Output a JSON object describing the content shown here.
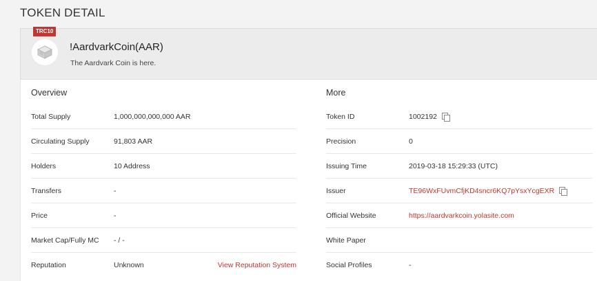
{
  "page": {
    "title": "TOKEN DETAIL"
  },
  "token": {
    "badge": "TRC10",
    "name": "!AardvarkCoin(AAR)",
    "description": "The Aardvark Coin is here."
  },
  "overview": {
    "title": "Overview",
    "rows": [
      {
        "label": "Total Supply",
        "value": "1,000,000,000,000 AAR"
      },
      {
        "label": "Circulating Supply",
        "value": "91,803 AAR"
      },
      {
        "label": "Holders",
        "value": "10 Address"
      },
      {
        "label": "Transfers",
        "value": "-"
      },
      {
        "label": "Price",
        "value": "-"
      },
      {
        "label": "Market Cap/Fully MC",
        "value": "- / -"
      },
      {
        "label": "Reputation",
        "value": "Unknown",
        "link": "View Reputation System"
      }
    ]
  },
  "more": {
    "title": "More",
    "rows": [
      {
        "label": "Token ID",
        "value": "1002192"
      },
      {
        "label": "Precision",
        "value": "0"
      },
      {
        "label": "Issuing Time",
        "value": "2019-03-18 15:29:33 (UTC)"
      },
      {
        "label": "Issuer",
        "value": "TE96WxFUvmCfjKD4sncr6KQ7pYsxYcgEXR"
      },
      {
        "label": "Official Website",
        "value": "https://aardvarkcoin.yolasite.com"
      },
      {
        "label": "White Paper",
        "value": ""
      },
      {
        "label": "Social Profiles",
        "value": "-"
      }
    ]
  },
  "colors": {
    "accent": "#c23631",
    "header_bg": "#ececec",
    "page_bg": "#f3f3f3"
  },
  "icons": {
    "token_logo": "cube-icon",
    "copy": "copy-icon"
  }
}
